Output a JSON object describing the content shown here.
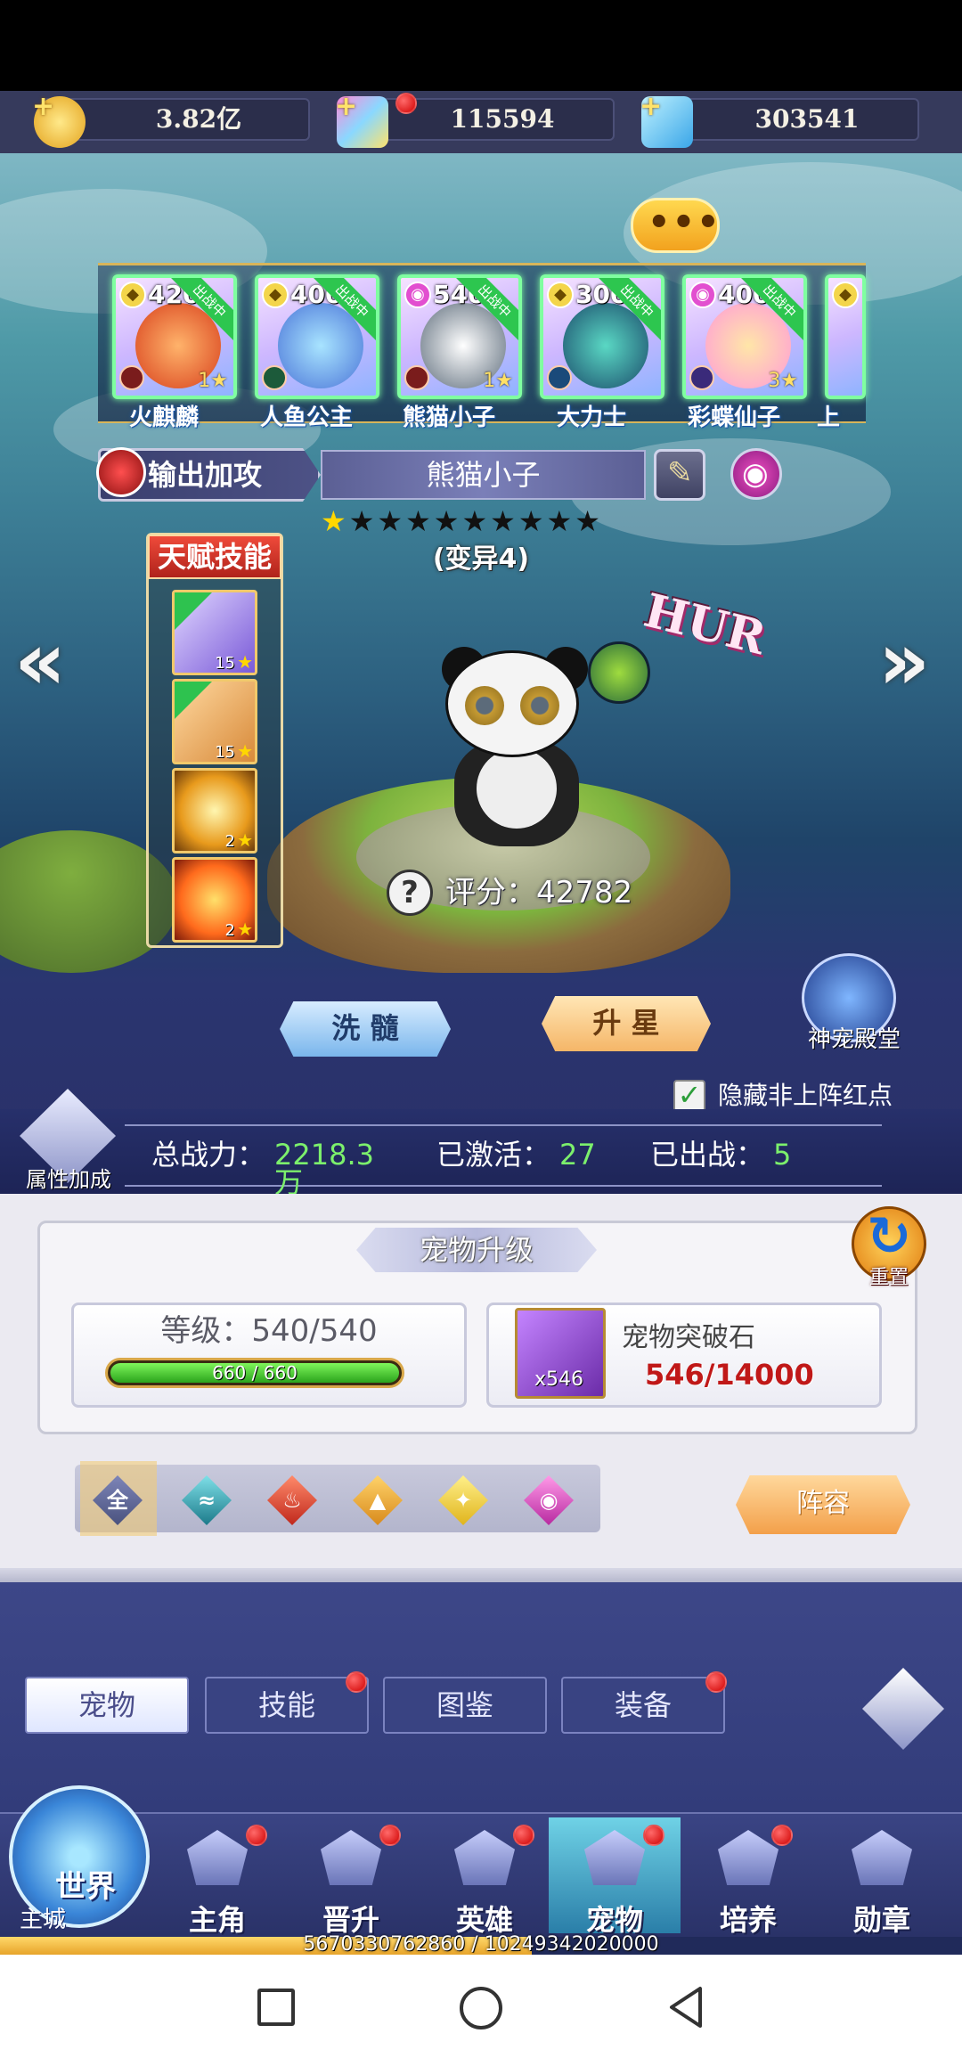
{
  "resources": {
    "gold": "3.82亿",
    "crystal": "115594",
    "diamond": "303541"
  },
  "heroes": [
    {
      "level": "420",
      "name": "火麒麟",
      "stars": "1",
      "status": "出战中"
    },
    {
      "level": "400",
      "name": "人鱼公主",
      "stars": "",
      "status": "出战中"
    },
    {
      "level": "540",
      "name": "熊猫小子",
      "stars": "1",
      "status": "出战中"
    },
    {
      "level": "300",
      "name": "大力士",
      "stars": "",
      "status": "出战中"
    },
    {
      "level": "400",
      "name": "彩蝶仙子",
      "stars": "3",
      "status": "出战中"
    },
    {
      "level": "",
      "name": "上",
      "stars": "",
      "status": ""
    }
  ],
  "pet": {
    "role": "输出加攻",
    "name": "熊猫小子",
    "stars_filled": 1,
    "stars_total": 10,
    "mutation": "(变异4)",
    "rank_badge": "HUR",
    "score_label": "评分：",
    "score": "42782"
  },
  "talent": {
    "title": "天赋技能",
    "skills": [
      {
        "level": "15",
        "tag": "满星"
      },
      {
        "level": "15",
        "tag": "满星"
      },
      {
        "level": "2",
        "tag": "星"
      },
      {
        "level": "2",
        "tag": "星"
      }
    ]
  },
  "actions": {
    "wash": "洗 髓",
    "star_up": "升 星",
    "god_hall": "神宠殿堂",
    "hide_label": "隐藏非上阵红点",
    "hide_checked": true
  },
  "power": {
    "attr_button": "属性加成",
    "total_label": "总战力：",
    "total_value": "2218.3",
    "total_unit": "万",
    "activated_label": "已激活：",
    "activated_value": "27",
    "deployed_label": "已出战：",
    "deployed_value": "5"
  },
  "upgrade": {
    "title": "宠物升级",
    "reset": "重置",
    "level_label": "等级：540/540",
    "exp_text": "660 / 660",
    "exp_fraction": 1.0,
    "stone_name": "宠物突破石",
    "stone_qty": "x546",
    "stone_progress": "546/14000"
  },
  "filters": {
    "all": "全",
    "lineup": "阵容"
  },
  "tabs": [
    "宠物",
    "技能",
    "图鉴",
    "装备"
  ],
  "bottom_nav": {
    "world": "世界",
    "main_city": "主城",
    "items": [
      "主角",
      "晋升",
      "英雄",
      "宠物",
      "培养",
      "勋章"
    ]
  },
  "exp_bar": {
    "text": "5670330762860 / 10249342020000",
    "fraction": 0.553
  },
  "colors": {
    "accent_green": "#7cf06c",
    "red_dot": "#d00000",
    "gold": "#ffd700"
  }
}
